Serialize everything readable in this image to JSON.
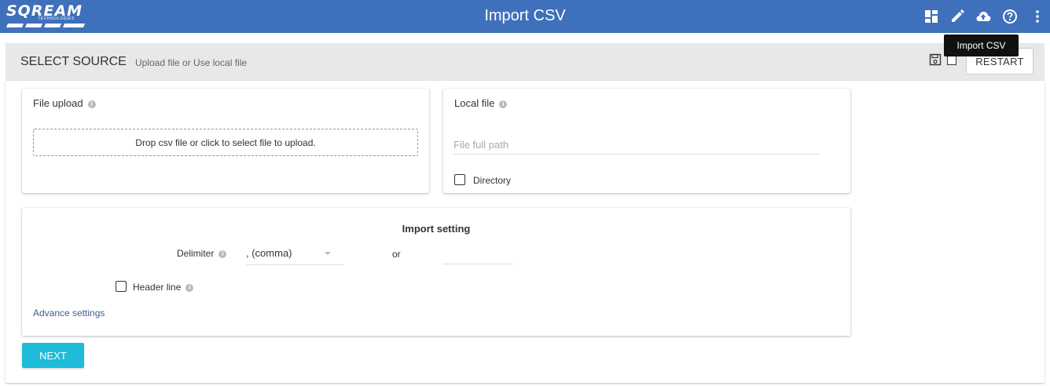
{
  "header": {
    "logo_text": "SQREAM",
    "logo_sub": "TECHNOLOGIES",
    "title": "Import CSV",
    "icons": [
      "dashboard-icon",
      "edit-icon",
      "cloud-upload-icon",
      "help-icon",
      "more-vert-icon"
    ],
    "tooltip": "Import CSV"
  },
  "source": {
    "title": "SELECT SOURCE",
    "subtitle": "Upload file or Use local file",
    "restart_label": "RESTART"
  },
  "file_upload": {
    "label": "File upload",
    "dropzone_text": "Drop csv file or click to select file to upload."
  },
  "local_file": {
    "label": "Local file",
    "path_placeholder": "File full path",
    "path_value": "",
    "directory_label": "Directory",
    "directory_checked": false
  },
  "import_setting": {
    "title": "Import setting",
    "delimiter_label": "Delimiter",
    "delimiter_value": ", (comma)",
    "or_label": "or",
    "custom_delimiter_value": "",
    "header_line_label": "Header line",
    "header_line_checked": false,
    "advance_label": "Advance settings"
  },
  "footer": {
    "next_label": "NEXT"
  },
  "colors": {
    "topbar": "#3f70bb",
    "accent": "#1ebcd8",
    "link": "#3f5f91"
  }
}
